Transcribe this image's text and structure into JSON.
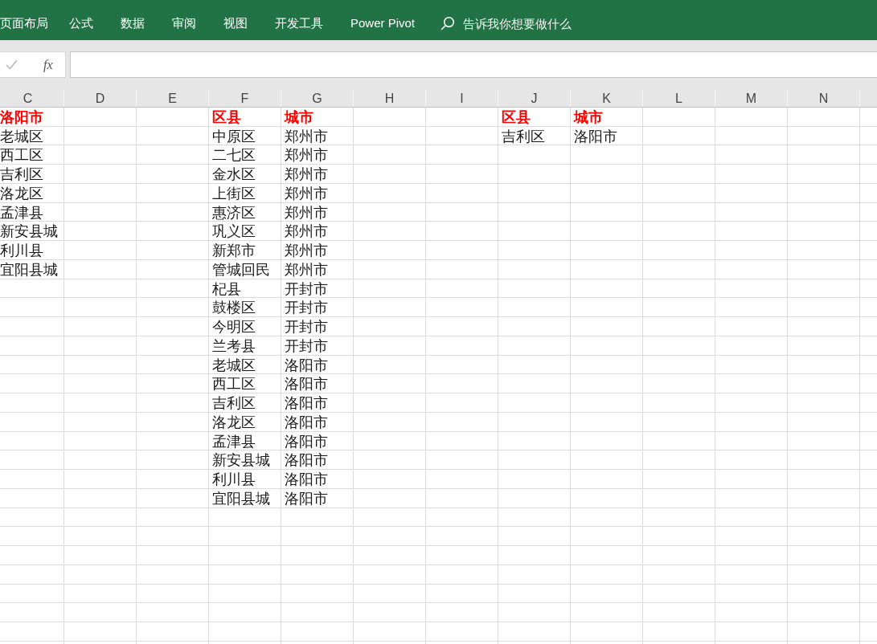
{
  "ribbon": {
    "tabs": [
      "页面布局",
      "公式",
      "数据",
      "审阅",
      "视图",
      "开发工具",
      "Power Pivot"
    ],
    "search": {
      "placeholder": "告诉我你想要做什么"
    }
  },
  "formula_bar": {
    "function_button": "fx"
  },
  "sheet": {
    "columns": [
      {
        "letter": "C",
        "heading": "洛阳市",
        "cells": [
          "老城区",
          "西工区",
          "吉利区",
          "洛龙区",
          "孟津县",
          "新安县城",
          "利川县",
          "宜阳县城"
        ]
      },
      {
        "letter": "D"
      },
      {
        "letter": "E"
      },
      {
        "letter": "F",
        "heading": "区县",
        "cells": [
          "中原区",
          "二七区",
          "金水区",
          "上街区",
          "惠济区",
          "巩义区",
          "新郑市",
          "管城回民",
          "杞县",
          "鼓楼区",
          "今明区",
          "兰考县",
          "老城区",
          "西工区",
          "吉利区",
          "洛龙区",
          "孟津县",
          "新安县城",
          "利川县",
          "宜阳县城"
        ]
      },
      {
        "letter": "G",
        "heading": "城市",
        "cells": [
          "郑州市",
          "郑州市",
          "郑州市",
          "郑州市",
          "郑州市",
          "郑州市",
          "郑州市",
          "郑州市",
          "开封市",
          "开封市",
          "开封市",
          "开封市",
          "洛阳市",
          "洛阳市",
          "洛阳市",
          "洛阳市",
          "洛阳市",
          "洛阳市",
          "洛阳市",
          "洛阳市"
        ]
      },
      {
        "letter": "H"
      },
      {
        "letter": "I"
      },
      {
        "letter": "J",
        "heading": "区县",
        "cells": [
          "吉利区"
        ]
      },
      {
        "letter": "K",
        "heading": "城市",
        "cells": [
          "洛阳市"
        ]
      },
      {
        "letter": "L"
      },
      {
        "letter": "M"
      },
      {
        "letter": "N"
      }
    ]
  }
}
